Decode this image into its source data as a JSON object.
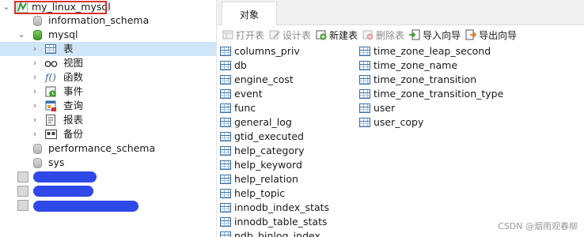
{
  "nav": {
    "connection": "my_linux_mysql",
    "databases": [
      {
        "name": "information_schema"
      },
      {
        "name": "mysql"
      }
    ],
    "mysql_children": [
      {
        "label": "表",
        "icon": "table-icon"
      },
      {
        "label": "视图",
        "icon": "view-glasses-icon"
      },
      {
        "label": "函数",
        "icon": "function-icon"
      },
      {
        "label": "事件",
        "icon": "event-clock-icon"
      },
      {
        "label": "查询",
        "icon": "query-icon"
      },
      {
        "label": "报表",
        "icon": "report-icon"
      },
      {
        "label": "备份",
        "icon": "backup-icon"
      }
    ],
    "other_databases": [
      {
        "name": "performance_schema"
      },
      {
        "name": "sys"
      }
    ]
  },
  "main": {
    "tab_label": "对象",
    "toolbar": [
      {
        "label": "打开表",
        "enabled": false,
        "icon": "open-table-icon"
      },
      {
        "label": "设计表",
        "enabled": false,
        "icon": "design-table-icon"
      },
      {
        "label": "新建表",
        "enabled": true,
        "icon": "new-table-icon"
      },
      {
        "label": "删除表",
        "enabled": false,
        "icon": "delete-table-icon"
      },
      {
        "label": "导入向导",
        "enabled": true,
        "icon": "import-wizard-icon"
      },
      {
        "label": "导出向导",
        "enabled": true,
        "icon": "export-wizard-icon"
      }
    ],
    "tables_col1": [
      "columns_priv",
      "db",
      "engine_cost",
      "event",
      "func",
      "general_log",
      "gtid_executed",
      "help_category",
      "help_keyword",
      "help_relation",
      "help_topic",
      "innodb_index_stats",
      "innodb_table_stats",
      "ndb_binlog_index"
    ],
    "tables_col2": [
      "time_zone_leap_second",
      "time_zone_name",
      "time_zone_transition",
      "time_zone_transition_type",
      "user",
      "user_copy"
    ]
  },
  "watermark": "CSDN @烟雨观春柳",
  "colors": {
    "selected_row": "#cfe6f8",
    "highlight_border": "#d8312a",
    "redaction": "#2f48e8"
  }
}
